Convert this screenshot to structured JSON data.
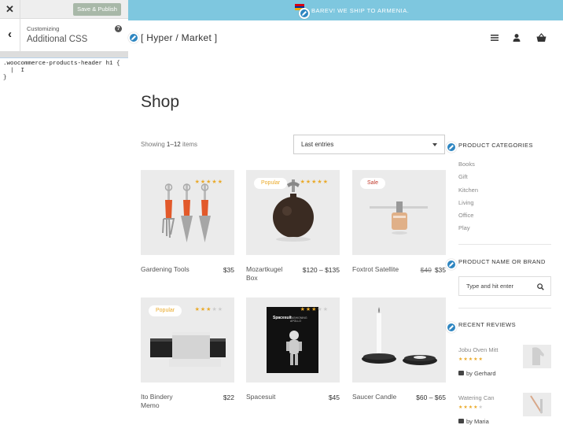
{
  "customizer": {
    "close_icon": "close-icon",
    "save_label": "Save & Publish",
    "back_icon": "chevron-left-icon",
    "subtitle": "Customizing",
    "title": "Additional CSS",
    "help_icon": "help-icon",
    "code_lines": [
      ".woocommerce-products-header h1 {",
      "  |  I",
      "}"
    ]
  },
  "banner": {
    "text": "BAREV! WE SHIP TO ARMENIA.",
    "color": "#7ec7df",
    "flag_colors": [
      "#d90012",
      "#0033a0",
      "#f2a800"
    ]
  },
  "header": {
    "logo": "[ Hyper / Market ]",
    "icons": [
      "menu-icon",
      "user-icon",
      "basket-icon"
    ]
  },
  "shop": {
    "title": "Shop",
    "showing_prefix": "Showing ",
    "showing_range": "1–12",
    "showing_suffix": " items",
    "sort_selected": "Last entries"
  },
  "products": [
    {
      "name": "Gardening Tools",
      "price": "$35",
      "old_price": "",
      "badge": "",
      "rating": 5
    },
    {
      "name": "Mozartkugel Box",
      "price": "$120 – $135",
      "old_price": "",
      "badge": "Popular",
      "rating": 5
    },
    {
      "name": "Foxtrot Satellite",
      "price": "$35",
      "old_price": "$40",
      "badge": "Sale",
      "rating": 0
    },
    {
      "name": "Ito Bindery Memo",
      "price": "$22",
      "old_price": "",
      "badge": "Popular",
      "rating": 3
    },
    {
      "name": "Spacesuit",
      "price": "$45",
      "old_price": "",
      "badge": "",
      "rating": 3
    },
    {
      "name": "Saucer Candle",
      "price": "$60 – $65",
      "old_price": "",
      "badge": "",
      "rating": 0
    }
  ],
  "book_cover": {
    "title": "Spacesuit",
    "subtitle": "FASHIONING APOLLO"
  },
  "sidebar": {
    "categories_title": "PRODUCT CATEGORIES",
    "categories": [
      "Books",
      "Gift",
      "Kitchen",
      "Living",
      "Office",
      "Play"
    ],
    "search_title": "PRODUCT NAME OR BRAND",
    "search_placeholder": "Type and hit enter",
    "reviews_title": "RECENT REVIEWS",
    "reviews": [
      {
        "product": "Jobu Oven Mitt",
        "rating": 5,
        "by": "by Gerhard"
      },
      {
        "product": "Watering Can",
        "rating": 4,
        "by": "by Maria"
      }
    ]
  },
  "colors": {
    "accent": "#2e86c1",
    "star": "#eaaa2a",
    "popular": "#eaaa2a",
    "sale": "#c0392b"
  }
}
